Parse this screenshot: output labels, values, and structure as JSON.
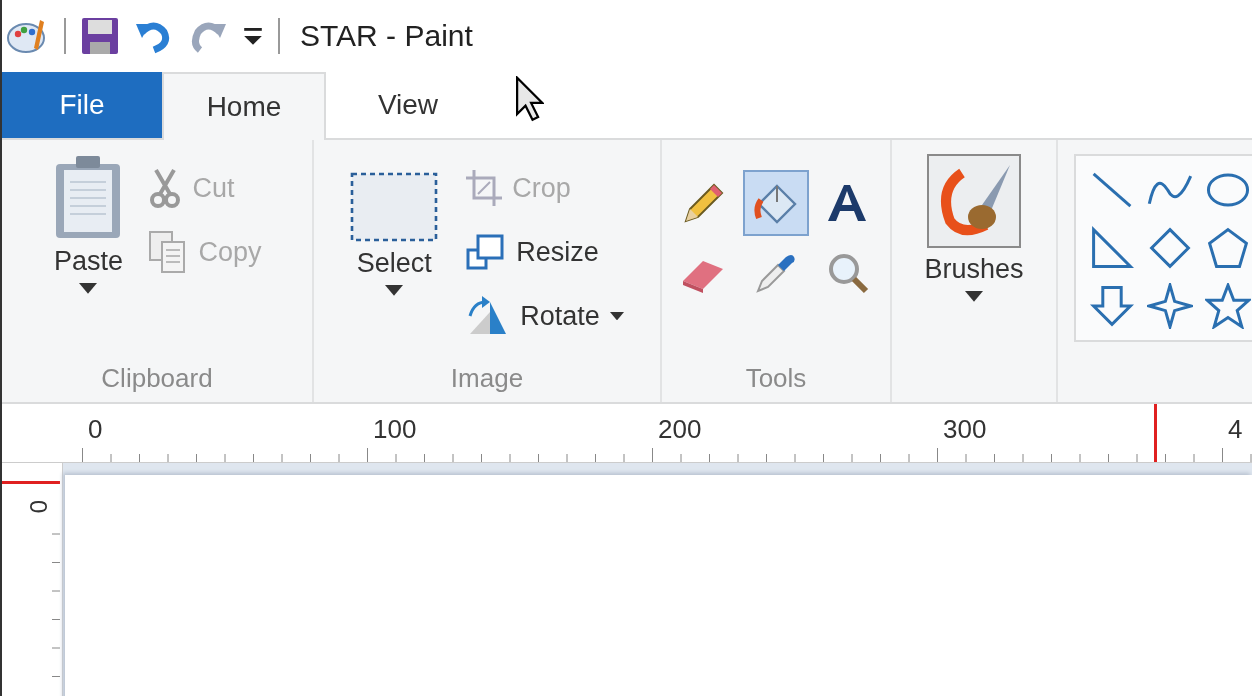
{
  "title_bar": {
    "title": "STAR - Paint",
    "quick_access": [
      {
        "kind": "save",
        "disabled": false
      },
      {
        "kind": "undo",
        "disabled": false
      },
      {
        "kind": "redo",
        "disabled": true
      }
    ]
  },
  "tabs": [
    {
      "label": "File",
      "kind": "file",
      "selected": false
    },
    {
      "label": "Home",
      "kind": "tab",
      "selected": true
    },
    {
      "label": "View",
      "kind": "tab",
      "selected": false
    }
  ],
  "ribbon": {
    "clipboard": {
      "label": "Clipboard",
      "paste": "Paste",
      "items": [
        {
          "label": "Cut",
          "kind": "cut",
          "disabled": true
        },
        {
          "label": "Copy",
          "kind": "copy",
          "disabled": true
        }
      ]
    },
    "image": {
      "label": "Image",
      "select": "Select",
      "items": [
        {
          "label": "Crop",
          "kind": "crop",
          "disabled": true,
          "dropdown": false
        },
        {
          "label": "Resize",
          "kind": "resize",
          "disabled": false,
          "dropdown": false
        },
        {
          "label": "Rotate",
          "kind": "rotate",
          "disabled": false,
          "dropdown": true
        }
      ]
    },
    "tools": {
      "label": "Tools",
      "items": [
        {
          "kind": "pencil",
          "selected": false
        },
        {
          "kind": "fill",
          "selected": true
        },
        {
          "kind": "text",
          "selected": false
        },
        {
          "kind": "eraser",
          "selected": false
        },
        {
          "kind": "picker",
          "selected": false
        },
        {
          "kind": "magnifier",
          "selected": false
        }
      ]
    },
    "brushes": {
      "label": "Brushes"
    },
    "shapes": [
      {
        "kind": "line"
      },
      {
        "kind": "curve"
      },
      {
        "kind": "oval"
      },
      {
        "kind": "triangle"
      },
      {
        "kind": "diamond"
      },
      {
        "kind": "pentagon"
      },
      {
        "kind": "arrow"
      },
      {
        "kind": "star4"
      },
      {
        "kind": "star5"
      }
    ]
  },
  "ruler": {
    "labels": [
      "0",
      "100",
      "200",
      "300",
      "4"
    ]
  },
  "vertical_ruler": {
    "labels": [
      "0"
    ]
  }
}
